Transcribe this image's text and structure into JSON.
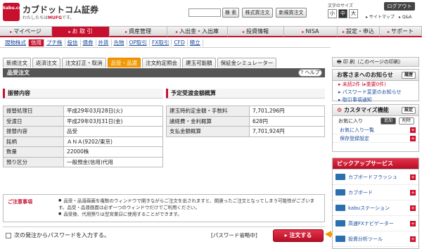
{
  "brand": {
    "logo_text": "kabu.com",
    "name": "カブドットコム証券",
    "tagline_prefix": "わたしたちは",
    "tagline_group": "MUFG",
    "tagline_suffix": "です。"
  },
  "header": {
    "search_button": "検 索",
    "stock_order_button": "株式買注文",
    "new_account_button": "新規買注文",
    "text_size_label": "文字のサイズ",
    "sizes": [
      "小",
      "中",
      "大"
    ],
    "logout": "ログアウト",
    "links": "▸ サイトマップ　▸ Q&A"
  },
  "mainnav": [
    "マイページ",
    "お 取 引",
    "資産管理",
    "入出金・入出庫",
    "投資情報",
    "NISA",
    "設定・申込",
    "サポート"
  ],
  "subnav": [
    "現物株式",
    "信用",
    "プチ株",
    "投信",
    "債券",
    "外貨",
    "先物",
    "OP取引",
    "FX取引",
    "CFD",
    "積立"
  ],
  "tabs": [
    "新規注文",
    "返済注文",
    "注文訂正・取消",
    "品受・品渡",
    "注文約定照会",
    "建玉可能額",
    "保証金シミュレーター"
  ],
  "section_title": "品受注文",
  "help": "ヘルプ",
  "left_table": {
    "title": "振替内容",
    "rows": [
      [
        "振替処理日",
        "平成29年03月28日(火)"
      ],
      [
        "受渡日",
        "平成29年03月31日(金)"
      ],
      [
        "振替内容",
        "品受"
      ],
      [
        "銘柄",
        "ＡＮＡ(9202/東京)"
      ],
      [
        "数量",
        "22000株"
      ],
      [
        "預り区分",
        "一般預金(信用)代用"
      ]
    ]
  },
  "right_table": {
    "title": "予定受渡金額概算",
    "rows": [
      [
        "建玉時約定金額・手数料",
        "7,701,296円"
      ],
      [
        "諸経費・金利概算",
        "628円"
      ],
      [
        "支払金額概算",
        "7,701,924円"
      ]
    ]
  },
  "notice": {
    "title": "ご注意事項",
    "items": [
      "品受・品渡画面を複数のウィンドウで開きながらご注文を出されますと、間違ったご注文となってしまう可能性がございます。品受・品渡画面は必ず一つのウィンドウだけでご利用ください。",
      "品受後、代用預りは翌営業日に使用することができます。"
    ]
  },
  "submit": {
    "checkbox_label": "次の発注からパスワードを入力する。",
    "pw_label": "[パスワード省略中]",
    "order_button": "注文する"
  },
  "sidebar": {
    "print": "印 刷（このページの印刷）",
    "notice_head": "お客さまへのお知らせ",
    "notice_btn": "履歴",
    "notice_lines": [
      "▸ 未読2件 (▸重要0件)",
      "▸ パスワード変更のお知らせ",
      "▸ 取引事項通知"
    ],
    "custom_head": "カスタマイズ機能",
    "custom_btn": "設定",
    "custom_sub": "お気に入り",
    "custom_add": "追加",
    "custom_del": "削除",
    "custom_links": [
      "お気に入り一覧",
      "保存登録設定"
    ],
    "pickup_head": "ピックアップサービス",
    "services": [
      "カブボードフラッシュ",
      "カブボード",
      "kabuステーション",
      "高速FXナビゲーター",
      "投資分析ツール"
    ]
  }
}
